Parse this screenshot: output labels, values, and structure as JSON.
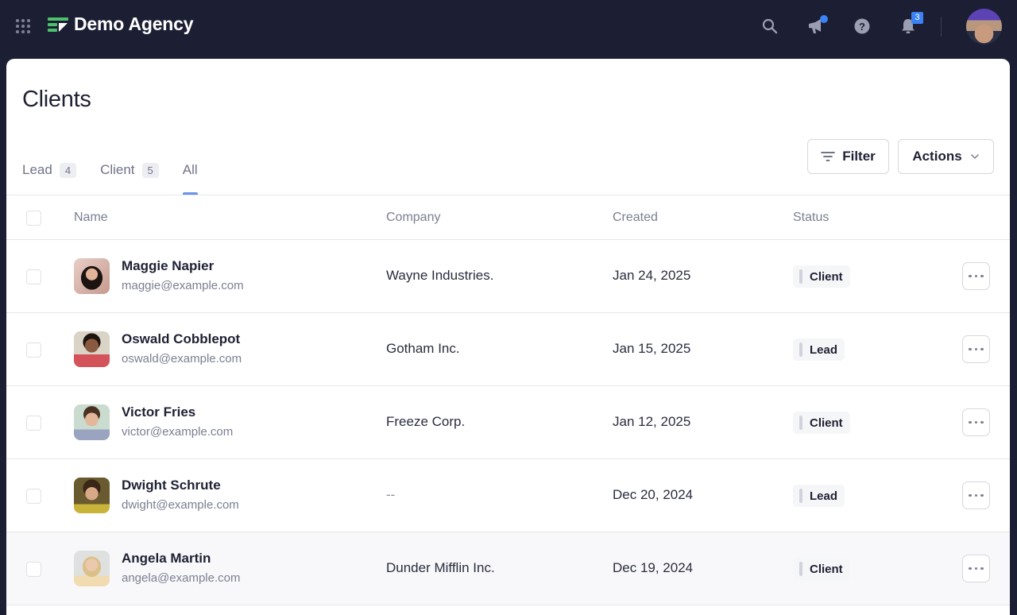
{
  "app": {
    "brand_name": "Demo Agency",
    "brand_color": "#4cc26b",
    "notifications_count": "3",
    "icons": {
      "apps": "apps-grid-icon",
      "search": "search-icon",
      "announcements": "megaphone-icon",
      "help": "help-icon",
      "notifications": "bell-icon"
    }
  },
  "page": {
    "title": "Clients"
  },
  "tabs": [
    {
      "label": "Lead",
      "count": "4",
      "active": false
    },
    {
      "label": "Client",
      "count": "5",
      "active": false
    },
    {
      "label": "All",
      "count": null,
      "active": true
    }
  ],
  "toolbar": {
    "filter_label": "Filter",
    "actions_label": "Actions"
  },
  "table": {
    "columns": [
      "Name",
      "Company",
      "Created",
      "Status"
    ],
    "rows": [
      {
        "name": "Maggie Napier",
        "email": "maggie@example.com",
        "company": "Wayne Industries.",
        "created": "Jan 24, 2025",
        "status": "Client"
      },
      {
        "name": "Oswald Cobblepot",
        "email": "oswald@example.com",
        "company": "Gotham Inc.",
        "created": "Jan 15, 2025",
        "status": "Lead"
      },
      {
        "name": "Victor Fries",
        "email": "victor@example.com",
        "company": "Freeze Corp.",
        "created": "Jan 12, 2025",
        "status": "Client"
      },
      {
        "name": "Dwight Schrute",
        "email": "dwight@example.com",
        "company": "--",
        "created": "Dec 20, 2024",
        "status": "Lead"
      },
      {
        "name": "Angela Martin",
        "email": "angela@example.com",
        "company": "Dunder Mifflin Inc.",
        "created": "Dec 19, 2024",
        "status": "Client"
      }
    ]
  },
  "colors": {
    "topbar_bg": "#1c1f33",
    "accent_blue": "#3b82f6",
    "tab_indicator": "#6d92e8"
  }
}
